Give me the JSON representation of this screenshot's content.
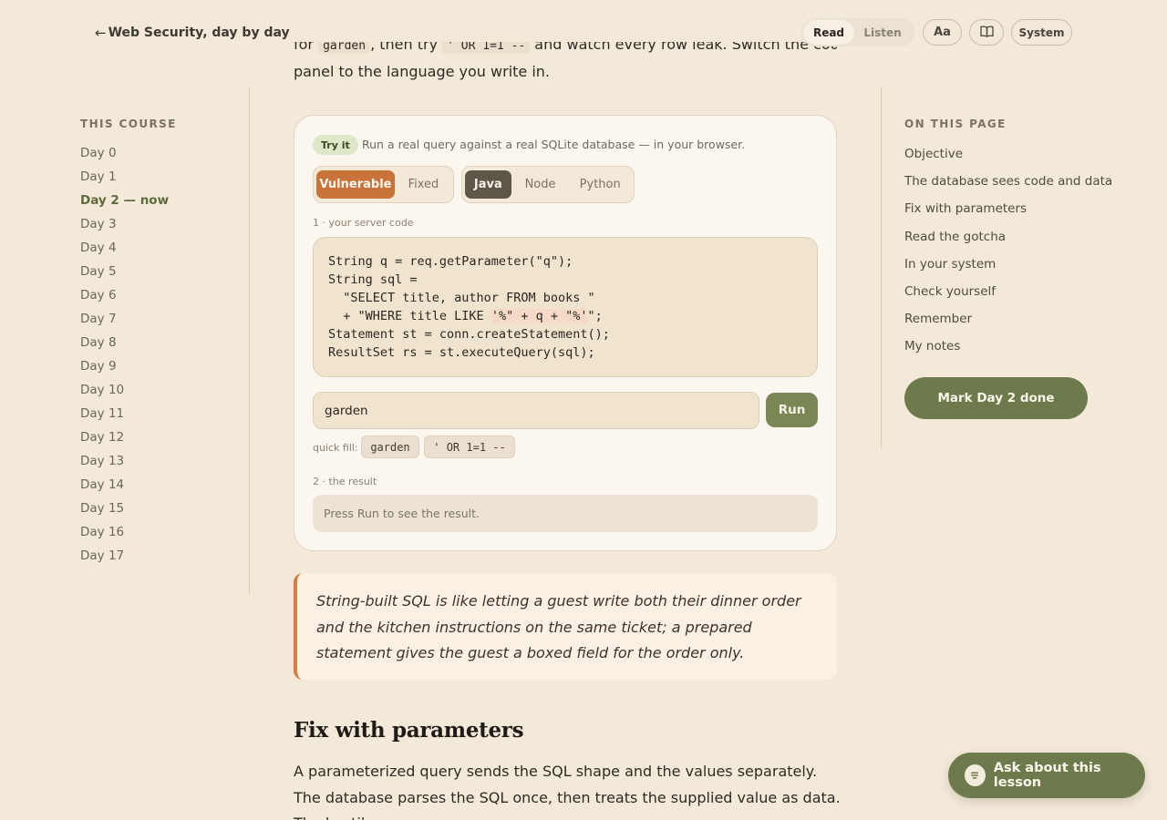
{
  "header": {
    "back_arrow": "←",
    "back_label": "Web Security, day by day",
    "mode_read": "Read",
    "mode_listen": "Listen",
    "font_button": "Aa",
    "book_icon": "book-open-icon",
    "theme_button": "System"
  },
  "left_nav": {
    "heading": "THIS COURSE",
    "days": [
      "Day 0",
      "Day 1",
      "Day 2 — now",
      "Day 3",
      "Day 4",
      "Day 5",
      "Day 6",
      "Day 7",
      "Day 8",
      "Day 9",
      "Day 10",
      "Day 11",
      "Day 12",
      "Day 13",
      "Day 14",
      "Day 15",
      "Day 16",
      "Day 17"
    ],
    "current_index": 2
  },
  "right_nav": {
    "heading": "ON THIS PAGE",
    "items": [
      "Objective",
      "The database sees code and data",
      "Fix with parameters",
      "Read the gotcha",
      "In your system",
      "Check yourself",
      "Remember",
      "My notes"
    ],
    "mark_done": "Mark Day 2 done"
  },
  "intro": {
    "line1_a": "for ",
    "line1_code1": "garden",
    "line1_b": ", then try ",
    "line1_code2": "' OR 1=1 --",
    "line1_c": " and watch every row leak. Switch the code",
    "line2": "panel to the language you write in."
  },
  "tryit": {
    "badge": "Try it",
    "description": "Run a real query against a real SQLite database — in your browser.",
    "mode_options": [
      "Vulnerable",
      "Fixed"
    ],
    "mode_selected": "Vulnerable",
    "lang_options": [
      "Java",
      "Node",
      "Python"
    ],
    "lang_selected": "Java",
    "step1_label": "1 · your server code",
    "code": {
      "l1": "String q = req.getParameter(\"q\");",
      "l2": "String sql =",
      "l3": "  \"SELECT title, author FROM books \"",
      "l4_a": "  + \"WHERE title LIKE ",
      "l4_hl": "'%\" + q + \"%'",
      "l4_b": "\";",
      "l5": "Statement st = conn.createStatement();",
      "l6": "ResultSet rs = st.executeQuery(sql);"
    },
    "input_value": "garden",
    "run_label": "Run",
    "quickfill_label": "quick fill:",
    "quickfill_chips": [
      "garden",
      "' OR 1=1 --"
    ],
    "step2_label": "2 · the result",
    "result_placeholder": "Press Run to see the result."
  },
  "callout": {
    "text": "String-built SQL is like letting a guest write both their dinner order and the kitchen instructions on the same ticket; a prepared statement gives the guest a boxed field for the order only."
  },
  "section": {
    "heading": "Fix with parameters",
    "paragraph": "A parameterized query sends the SQL shape and the values separately. The database parses the SQL once, then treats the supplied value as data. The hostile"
  },
  "assistant": {
    "label": "Ask about this lesson",
    "icon": "chat-icon"
  },
  "colors": {
    "background": "#f3e9d9",
    "accent_green": "#6d7b4c",
    "accent_orange": "#c9733b"
  }
}
